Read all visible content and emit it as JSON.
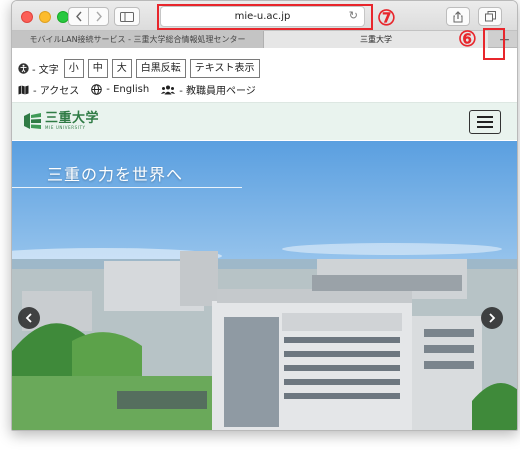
{
  "browser": {
    "url": "mie-u.ac.jp",
    "tabs": [
      {
        "label": "モバイルLAN接続サービス - 三重大学総合情報処理センター",
        "active": false
      },
      {
        "label": "三重大学",
        "active": true
      }
    ],
    "new_tab_label": "+",
    "callouts": {
      "url_marker": "⑦",
      "new_tab_marker": "⑥"
    }
  },
  "accessibility": {
    "label": "- 文字",
    "buttons": [
      "小",
      "中",
      "大",
      "白黒反転",
      "テキスト表示"
    ]
  },
  "nav": {
    "access": "- アクセス",
    "english": "- English",
    "staff": "- 教職員用ページ"
  },
  "header": {
    "logo_ja": "三重大学",
    "logo_en": "MIE UNIVERSITY"
  },
  "hero": {
    "title": "三重の力を世界へ"
  },
  "colors": {
    "accent_red": "#e8262c",
    "brand_green": "#2f7b45",
    "header_bg": "#e9f3ee"
  }
}
